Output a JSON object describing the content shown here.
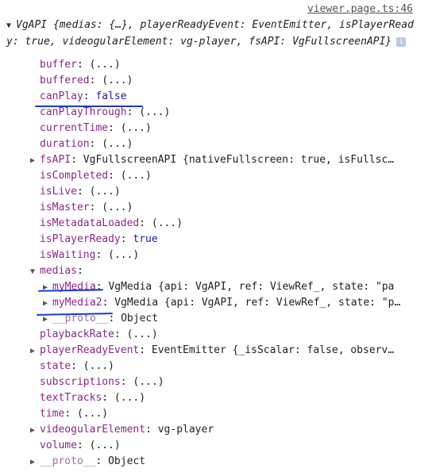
{
  "source_link": "viewer.page.ts:46",
  "summary": {
    "class_name": "VgAPI",
    "preview": "{medias: {…}, playerReadyEvent: EventEmitter, isPlayerReady: true, videogularElement: vg-player, fsAPI: VgFullscreenAPI}",
    "info_glyph": "i"
  },
  "properties": [
    {
      "key": "buffer",
      "value": "(...)",
      "level": 0
    },
    {
      "key": "buffered",
      "value": "(...)",
      "level": 0
    },
    {
      "key": "canPlay",
      "value": "false",
      "level": 0,
      "value_type": "keyword"
    },
    {
      "key": "canPlayThrough",
      "value": "(...)",
      "level": 0
    },
    {
      "key": "currentTime",
      "value": "(...)",
      "level": 0
    },
    {
      "key": "duration",
      "value": "(...)",
      "level": 0
    },
    {
      "key": "fsAPI",
      "value": "VgFullscreenAPI {nativeFullscreen: true, isFullsc…",
      "level": 0,
      "expandable": true
    },
    {
      "key": "isCompleted",
      "value": "(...)",
      "level": 0
    },
    {
      "key": "isLive",
      "value": "(...)",
      "level": 0
    },
    {
      "key": "isMaster",
      "value": "(...)",
      "level": 0
    },
    {
      "key": "isMetadataLoaded",
      "value": "(...)",
      "level": 0
    },
    {
      "key": "isPlayerReady",
      "value": "true",
      "level": 0,
      "value_type": "keyword"
    },
    {
      "key": "isWaiting",
      "value": "(...)",
      "level": 0
    },
    {
      "key": "medias",
      "value": "",
      "level": 0,
      "expanded": true
    },
    {
      "key": "myMedia",
      "value": "VgMedia {api: VgAPI, ref: ViewRef_, state: \"pa",
      "level": 1,
      "expandable": true
    },
    {
      "key": "myMedia2",
      "value": "VgMedia {api: VgAPI, ref: ViewRef_, state: \"p…",
      "level": 1,
      "expandable": true
    },
    {
      "key": "__proto__",
      "value": "Object",
      "level": 1,
      "expandable": true,
      "faded": true
    },
    {
      "key": "playbackRate",
      "value": "(...)",
      "level": 0
    },
    {
      "key": "playerReadyEvent",
      "value": "EventEmitter {_isScalar: false, observ…",
      "level": 0,
      "expandable": true
    },
    {
      "key": "state",
      "value": "(...)",
      "level": 0
    },
    {
      "key": "subscriptions",
      "value": "(...)",
      "level": 0
    },
    {
      "key": "textTracks",
      "value": "(...)",
      "level": 0
    },
    {
      "key": "time",
      "value": "(...)",
      "level": 0
    },
    {
      "key": "videogularElement",
      "value": "vg-player",
      "level": 0,
      "expandable": true
    },
    {
      "key": "volume",
      "value": "(...)",
      "level": 0
    },
    {
      "key": "__proto__",
      "value": "Object",
      "level": 0,
      "expandable": true,
      "faded": true
    }
  ],
  "colors": {
    "property_key": "#8e258c",
    "keyword_value": "#1a1aa6",
    "string_value": "#c41a16",
    "annotation_ink": "#1a3ccc"
  }
}
